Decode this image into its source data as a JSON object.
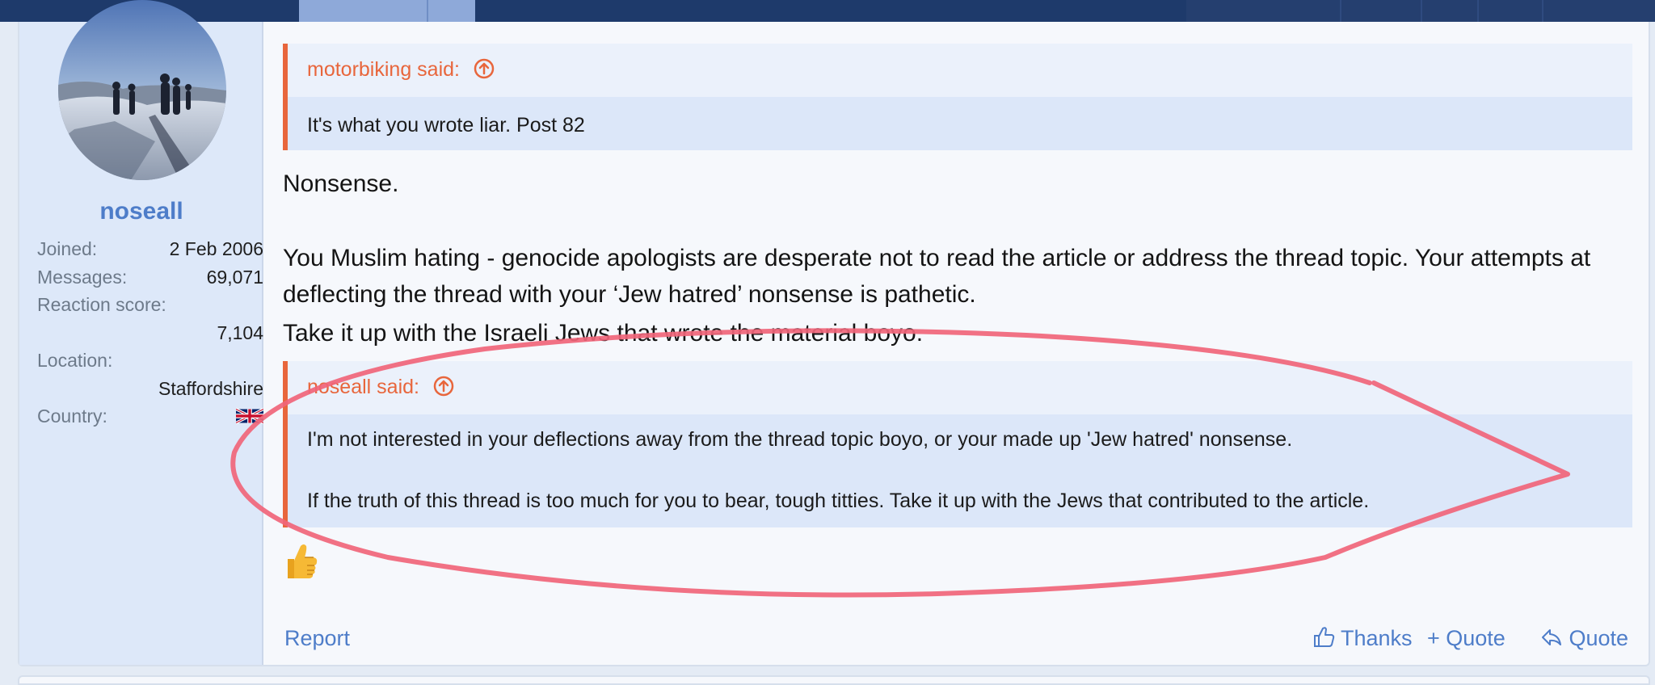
{
  "user": {
    "name": "noseall",
    "joined_label": "Joined:",
    "joined_value": "2 Feb 2006",
    "messages_label": "Messages:",
    "messages_value": "69,071",
    "reaction_label": "Reaction score:",
    "reaction_value": "7,104",
    "location_label": "Location:",
    "location_value": "Staffordshire",
    "country_label": "Country:",
    "country_flag_icon": "uk-flag-icon",
    "avatar_icon": "avatar-skiers-photo"
  },
  "post": {
    "quote1": {
      "author": "motorbiking said:",
      "text": "It's what you wrote liar. Post 82"
    },
    "message_line1": "Nonsense.",
    "message_line2": "You Muslim hating - genocide apologists are desperate not to read the article or address the thread topic. Your attempts at deflecting the thread with your ‘Jew hatred’ nonsense is pathetic.",
    "message_line3": "Take it up with the Israeli Jews that wrote the material boyo.",
    "quote2": {
      "author": "noseall said:",
      "text_line1": "I'm not interested in your deflections away from the thread topic boyo, or your made up 'Jew hatred' nonsense.",
      "text_line2": "If the truth of this thread is too much for you to bear, tough titties. Take it up with the Jews that contributed to the article."
    },
    "reaction_emoji_icon": "thumbs-up-emoji"
  },
  "actions": {
    "report": "Report",
    "thanks": "Thanks",
    "multi_quote": "+ Quote",
    "quote": "Quote"
  },
  "colors": {
    "accent": "#4e7dc9",
    "quote_border": "#e8663c",
    "annotation": "#f0657a",
    "nav": "#1e3a6b"
  }
}
